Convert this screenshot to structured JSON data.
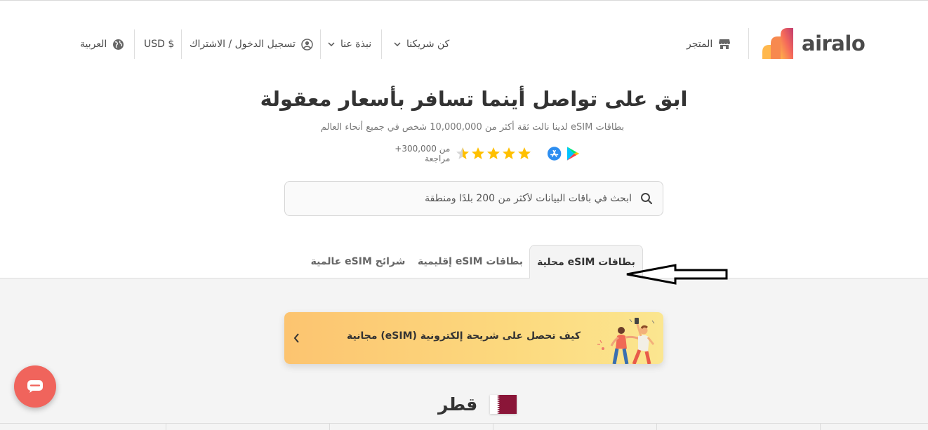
{
  "brand": {
    "name": "airalo"
  },
  "header": {
    "store": "المتجر",
    "partner": "كن شريكنا",
    "about": "نبذة عنا",
    "login": "تسجيل الدخول / الاشتراك",
    "currency": "USD $",
    "language": "العربية"
  },
  "hero": {
    "title": "ابق على تواصل أينما تسافر بأسعار معقولة",
    "subtitle": "بطاقات eSIM لدينا نالت ثقة أكثر من 10,000,000 شخص في جميع أنحاء العالم",
    "reviews": "من 300,000+ مراجعة",
    "rating": 4.5
  },
  "search": {
    "placeholder": "ابحث في باقات البيانات لأكثر من 200 بلدًا ومنطقة"
  },
  "tabs": [
    {
      "label": "بطاقات eSIM محلية",
      "active": true
    },
    {
      "label": "بطاقات eSIM إقليمية",
      "active": false
    },
    {
      "label": "شرائح eSIM عالمية",
      "active": false
    }
  ],
  "banner": {
    "text": "كيف تحصل على شريحة إلكترونية (eSIM) مجانية"
  },
  "country": {
    "name": "قطر"
  },
  "colors": {
    "accent": "#f0645c",
    "star": "#ffc000",
    "banner": "#fcd27a",
    "flag": "#8a1538"
  }
}
